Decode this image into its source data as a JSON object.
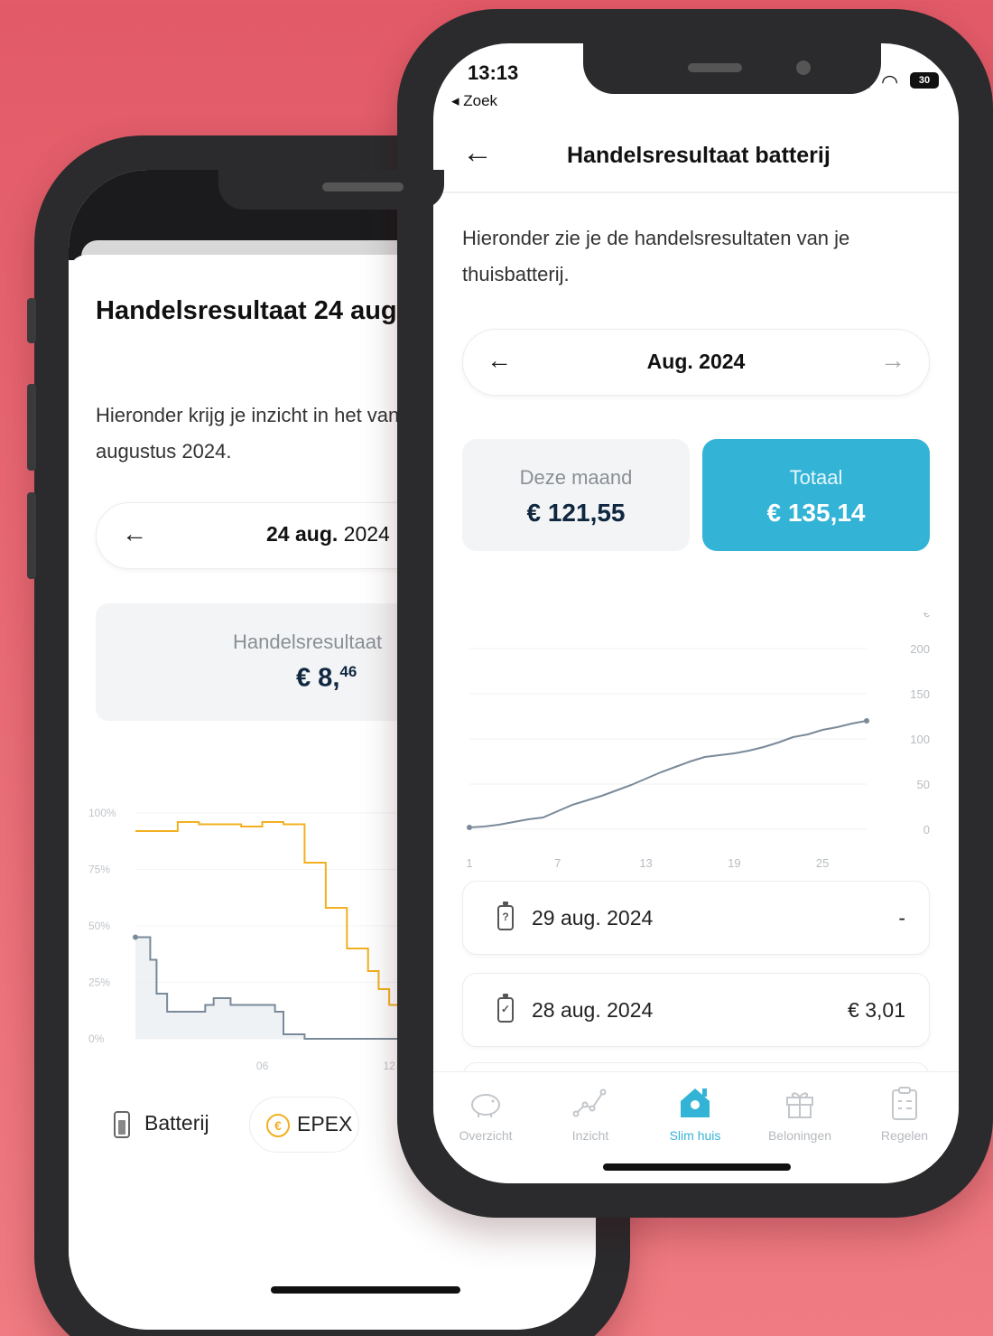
{
  "colors": {
    "background": "#e55f6c",
    "accent": "#33b4d6",
    "navy": "#0f2740",
    "epex_yellow": "#f2b020",
    "battery_line": "#7a8a99"
  },
  "back_phone": {
    "title": "Handelsresultaat 24 aug",
    "description": "Hieronder krijg je inzicht in het van 24 augustus 2024.",
    "date_nav": {
      "prev_icon": "←",
      "date_bold": "24 aug.",
      "date_year": " 2024"
    },
    "result": {
      "label": "Handelsresultaat",
      "value_main": "€ 8,",
      "value_cents": "46"
    },
    "chart_data": {
      "type": "line",
      "y_ticks": [
        "100%",
        "75%",
        "50%",
        "25%",
        "0%"
      ],
      "x_ticks": [
        "06",
        "12"
      ],
      "ylim": [
        0,
        100
      ],
      "series": [
        {
          "name": "Batterij",
          "color": "#7a8a99",
          "shape": "step",
          "x": [
            0,
            0.7,
            1,
            1.5,
            2,
            2.5,
            3,
            3.3,
            3.7,
            4,
            4.5,
            5,
            5.5,
            6,
            6.2,
            6.6,
            7,
            8,
            9,
            10,
            11,
            12,
            12.8,
            13.3,
            13.8
          ],
          "values": [
            45,
            35,
            20,
            12,
            12,
            12,
            12,
            15,
            18,
            18,
            15,
            15,
            15,
            15,
            15,
            12,
            2,
            0,
            0,
            0,
            0,
            0,
            10,
            58,
            70
          ]
        },
        {
          "name": "EPEX",
          "color": "#f2b020",
          "shape": "step",
          "x": [
            0,
            1,
            2,
            3,
            4,
            5,
            6,
            7,
            7.5,
            8,
            8.5,
            9,
            9.5,
            10,
            10.5,
            11,
            11.5,
            12,
            12.5,
            13,
            13.5
          ],
          "values": [
            92,
            92,
            96,
            95,
            95,
            94,
            96,
            95,
            95,
            78,
            78,
            58,
            58,
            40,
            40,
            30,
            22,
            15,
            0,
            0,
            7
          ]
        }
      ]
    },
    "legend": {
      "battery": "Batterij",
      "epex": "EPEX",
      "epex_icon": "€"
    }
  },
  "front_phone": {
    "status": {
      "time": "13:13",
      "back_link": "◂ Zoek",
      "battery": "30"
    },
    "nav": {
      "back_icon": "←",
      "title": "Handelsresultaat batterij"
    },
    "description": "Hieronder zie je de handelsresultaten van je thuisbatterij.",
    "period": {
      "prev_icon": "←",
      "label": "Aug. 2024",
      "next_icon": "→"
    },
    "cards": {
      "month": {
        "label": "Deze maand",
        "value": "€ 121,55"
      },
      "total": {
        "label": "Totaal",
        "value": "€ 135,14"
      }
    },
    "chart_data": {
      "type": "line",
      "y_unit": "€",
      "y_ticks": [
        "200",
        "150",
        "100",
        "50",
        "0"
      ],
      "x_ticks": [
        "1",
        "7",
        "13",
        "19",
        "25"
      ],
      "ylim": [
        0,
        200
      ],
      "xlim": [
        1,
        28
      ],
      "series": [
        {
          "name": "",
          "color": "#7a8a99",
          "x": [
            1,
            2,
            3,
            4,
            5,
            6,
            7,
            8,
            9,
            10,
            11,
            12,
            13,
            14,
            15,
            16,
            17,
            18,
            19,
            20,
            21,
            22,
            23,
            24,
            25,
            26,
            27,
            28
          ],
          "values": [
            2,
            3,
            5,
            8,
            11,
            13,
            20,
            27,
            32,
            37,
            43,
            49,
            56,
            63,
            69,
            75,
            80,
            82,
            84,
            87,
            91,
            96,
            102,
            105,
            110,
            113,
            117,
            120
          ]
        }
      ]
    },
    "days": [
      {
        "date": "29 aug. 2024",
        "amount": "-",
        "status_icon": "?"
      },
      {
        "date": "28 aug. 2024",
        "amount": "€ 3,01",
        "status_icon": "✓"
      }
    ],
    "tabs": [
      {
        "label": "Overzicht",
        "icon": "piggy-bank-icon",
        "active": false
      },
      {
        "label": "Inzicht",
        "icon": "line-graph-icon",
        "active": false
      },
      {
        "label": "Slim huis",
        "icon": "smart-home-icon",
        "active": true
      },
      {
        "label": "Beloningen",
        "icon": "gift-icon",
        "active": false
      },
      {
        "label": "Regelen",
        "icon": "clipboard-icon",
        "active": false
      }
    ]
  }
}
